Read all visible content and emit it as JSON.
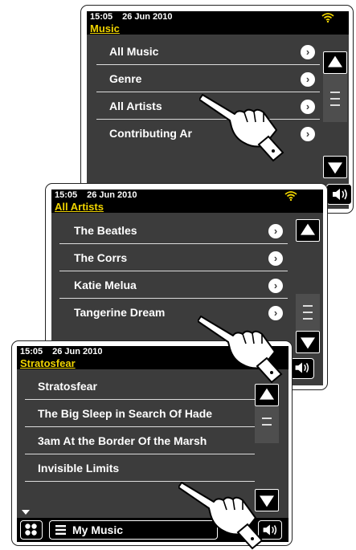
{
  "screen1": {
    "time": "15:05",
    "date": "26 Jun 2010",
    "title": "Music",
    "items": [
      {
        "label": "All Music"
      },
      {
        "label": "Genre"
      },
      {
        "label": "All Artists"
      },
      {
        "label": "Contributing Ar"
      }
    ]
  },
  "screen2": {
    "time": "15:05",
    "date": "26 Jun 2010",
    "title": "All Artists",
    "items": [
      {
        "label": "The Beatles"
      },
      {
        "label": "The Corrs"
      },
      {
        "label": "Katie Melua"
      },
      {
        "label": "Tangerine Dream"
      }
    ]
  },
  "screen3": {
    "time": "15:05",
    "date": "26 Jun 2010",
    "title": "Stratosfear",
    "items": [
      {
        "label": "Stratosfear"
      },
      {
        "label": "The Big Sleep in Search Of Hade"
      },
      {
        "label": "3am At the Border Of the Marsh"
      },
      {
        "label": "Invisible Limits"
      }
    ],
    "bottom": {
      "menu_label": "My Music"
    }
  },
  "colors": {
    "title_yellow": "#f0d400",
    "panel_gray": "#3c3c3c",
    "wifi_yellow": "#f0d400"
  },
  "icons": [
    "wifi-icon",
    "chevron-right-icon",
    "scroll-up-icon",
    "scroll-down-icon",
    "volume-icon",
    "home-grid-icon",
    "menu-list-icon",
    "pointing-hand-icon"
  ]
}
